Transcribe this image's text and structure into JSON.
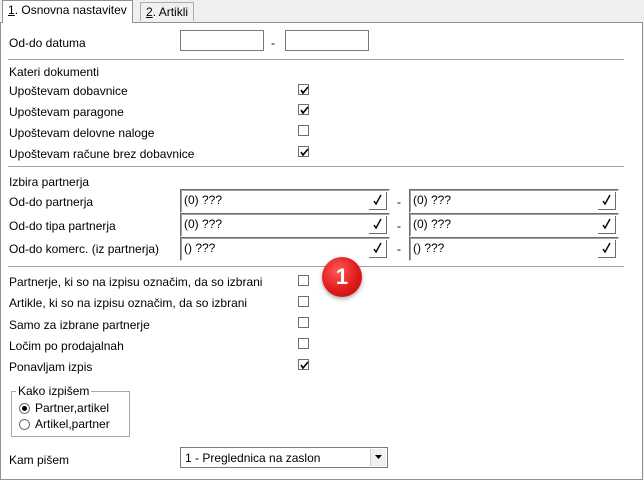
{
  "tabs": [
    {
      "accel": "1",
      "label": ". Osnovna nastavitev"
    },
    {
      "accel": "2",
      "label": ". Artikli"
    }
  ],
  "date_range": {
    "label": "Od-do datuma",
    "from": "",
    "to": "",
    "separator": "-"
  },
  "documents": {
    "title": "Kateri dokumenti",
    "items": [
      {
        "label": "Upoštevam dobavnice",
        "checked": true
      },
      {
        "label": "Upoštevam paragone",
        "checked": true
      },
      {
        "label": "Upoštevam delovne naloge",
        "checked": false
      },
      {
        "label": "Upoštevam račune brez dobavnice",
        "checked": true
      }
    ]
  },
  "partners": {
    "title": "Izbira partnerja",
    "rows": [
      {
        "label": "Od-do partnerja",
        "from": "(0) ???",
        "to": "(0) ???",
        "separator": "-"
      },
      {
        "label": "Od-do tipa partnerja",
        "from": "(0) ???",
        "to": "(0) ???",
        "separator": "-"
      },
      {
        "label": "Od-do komerc. (iz partnerja)",
        "from": "() ???",
        "to": "() ???",
        "separator": "-"
      }
    ]
  },
  "options": [
    {
      "label": "Partnerje, ki so na izpisu označim, da so izbrani",
      "checked": false
    },
    {
      "label": "Artikle, ki so na izpisu označim, da so izbrani",
      "checked": false
    },
    {
      "label": "Samo za izbrane partnerje",
      "checked": false
    },
    {
      "label": "Ločim po prodajalnah",
      "checked": false
    },
    {
      "label": "Ponavljam izpis",
      "checked": true
    }
  ],
  "write_mode": {
    "title": "Kako izpišem",
    "options": [
      {
        "label": "Partner,artikel",
        "selected": true
      },
      {
        "label": "Artikel,partner",
        "selected": false
      }
    ]
  },
  "output": {
    "label": "Kam pišem",
    "value": "1 - Preglednica na zaslon"
  },
  "annotation": {
    "number": "1",
    "color": "#e01b1b"
  }
}
